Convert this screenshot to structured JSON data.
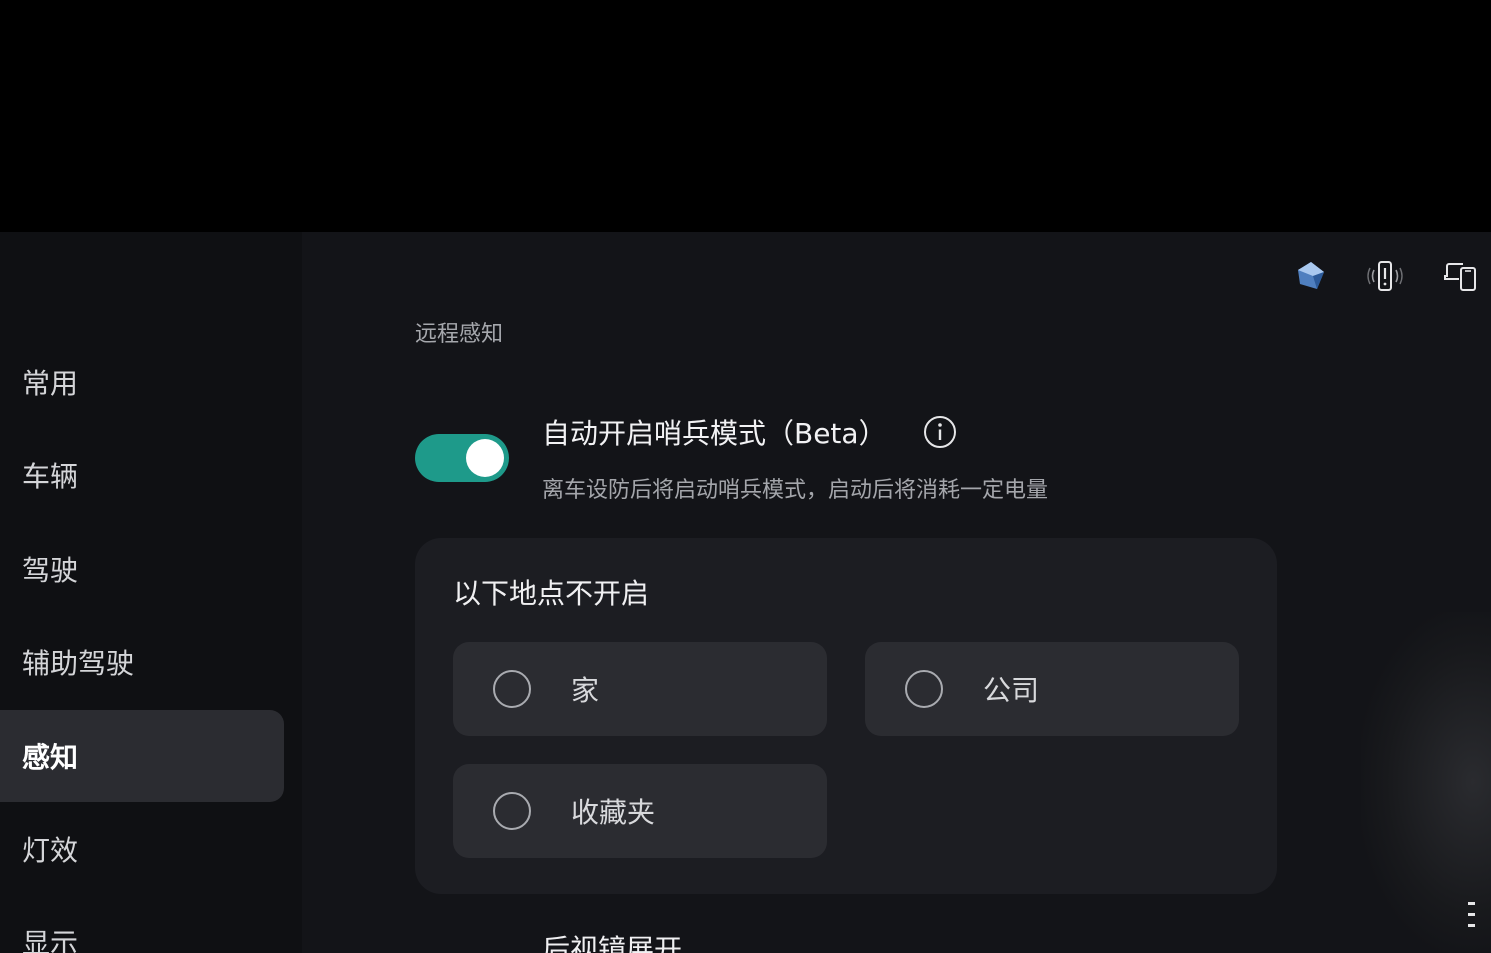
{
  "sidebar": {
    "items": [
      {
        "label": "常用",
        "active": false
      },
      {
        "label": "车辆",
        "active": false
      },
      {
        "label": "驾驶",
        "active": false
      },
      {
        "label": "辅助驾驶",
        "active": false
      },
      {
        "label": "感知",
        "active": true
      },
      {
        "label": "灯效",
        "active": false
      },
      {
        "label": "显示",
        "active": false
      }
    ]
  },
  "status_icons": [
    "cube-icon",
    "phone-alert-icon",
    "device-mirror-icon"
  ],
  "main": {
    "section_title": "远程感知",
    "sentry": {
      "title": "自动开启哨兵模式（Beta）",
      "description": "离车设防后将启动哨兵模式，启动后将消耗一定电量",
      "enabled": true
    },
    "exclusion_card": {
      "title": "以下地点不开启",
      "options": [
        {
          "label": "家",
          "selected": false
        },
        {
          "label": "公司",
          "selected": false
        },
        {
          "label": "收藏夹",
          "selected": false
        }
      ]
    },
    "next_setting_title": "后视镜展开"
  },
  "colors": {
    "accent": "#1e9a8a",
    "sidebar_bg": "#0f1013",
    "main_bg": "#131418",
    "card_bg": "#1c1d22",
    "option_bg": "#2b2c31"
  }
}
